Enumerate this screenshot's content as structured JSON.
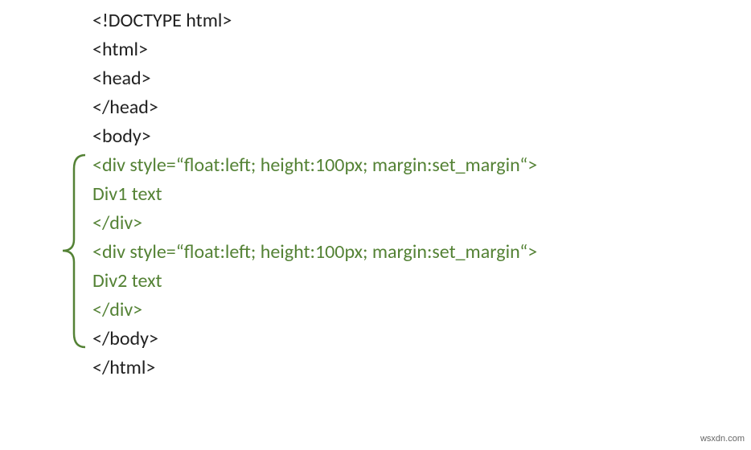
{
  "lines": {
    "l1": "<!DOCTYPE html>",
    "l2": "<html>",
    "l3": "<head>",
    "l4": "</head>",
    "l5": "<body>",
    "l6": "<div style=“float:left; height:100px; margin:set_margin“>",
    "l7": "Div1 text",
    "l8": "</div>",
    "l9": "<div style=“float:left; height:100px; margin:set_margin“>",
    "l10": "Div2 text",
    "l11": "</div>",
    "l12": "</body>",
    "l13": "</html>"
  },
  "watermark": "wsxdn.com"
}
